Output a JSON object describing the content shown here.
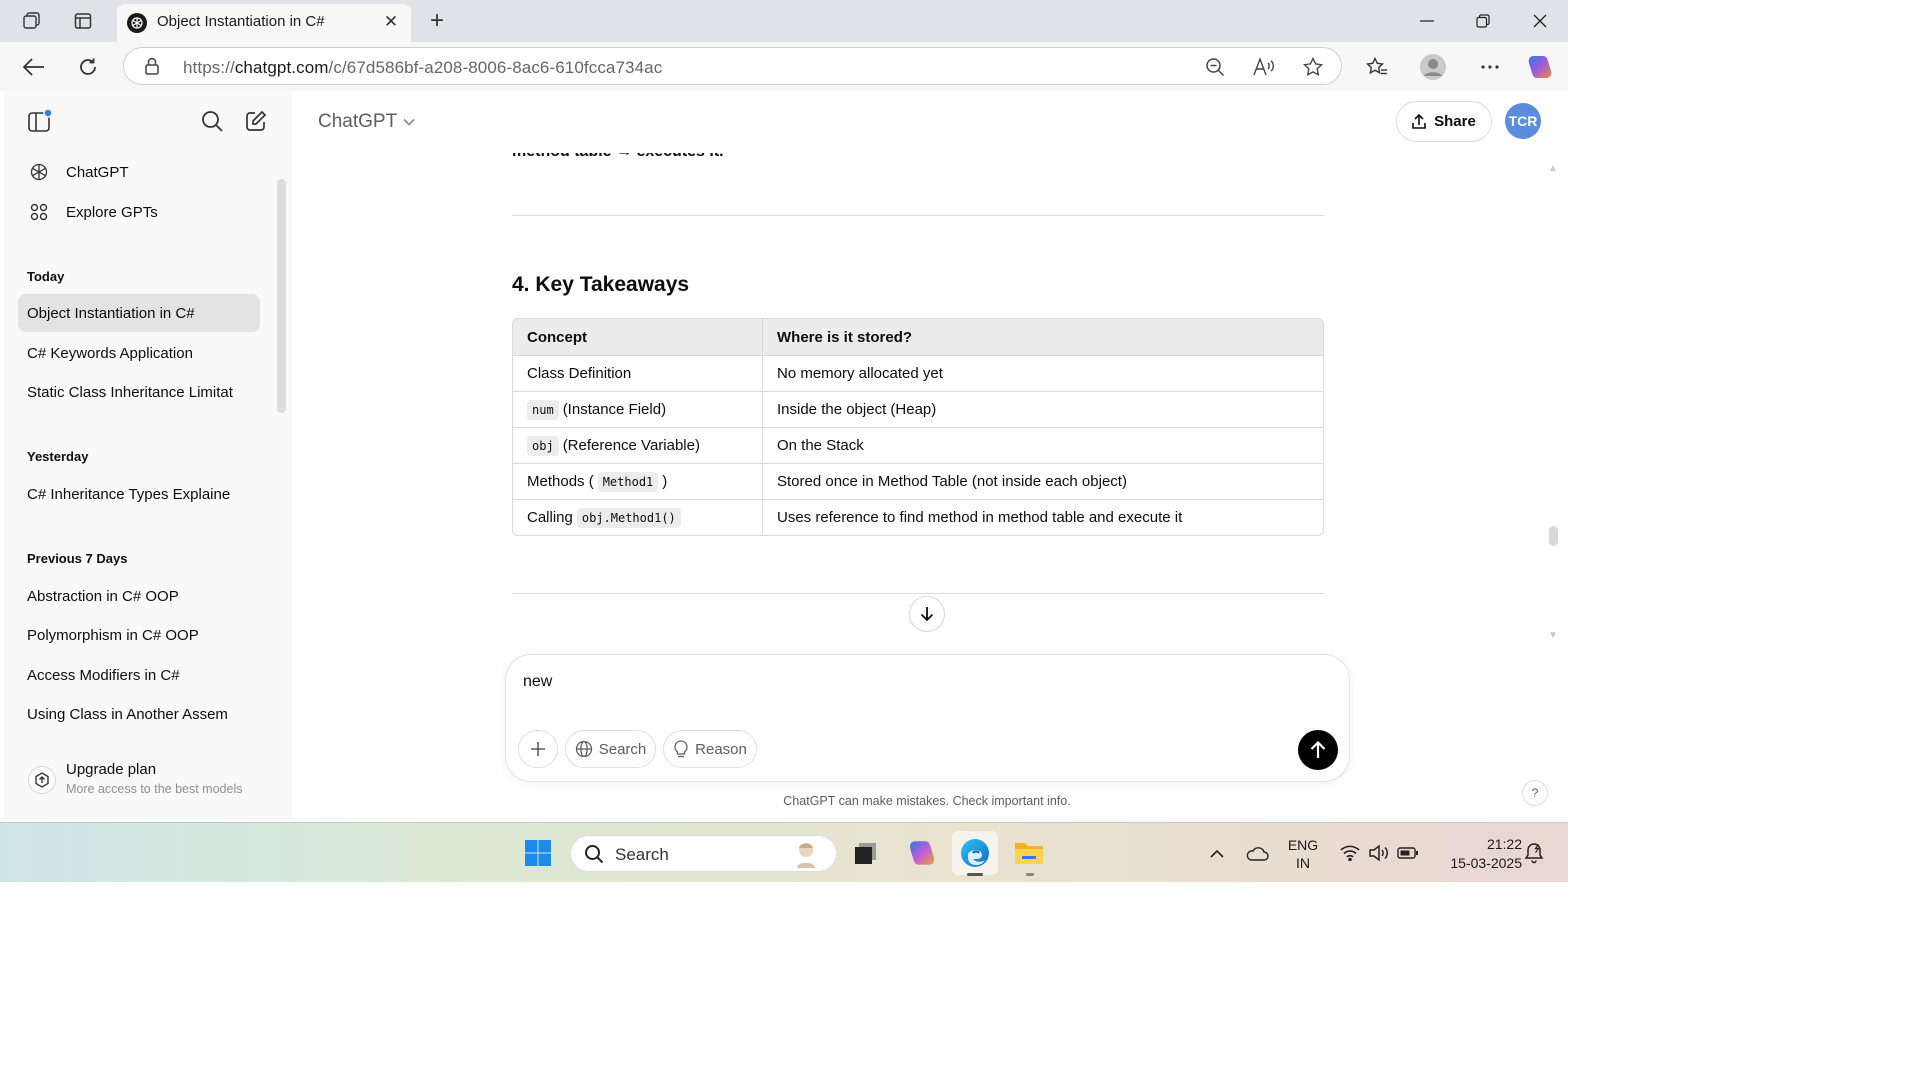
{
  "browser": {
    "tab_title": "Object Instantiation in C#",
    "url_prefix": "https://",
    "url_domain": "chatgpt.com",
    "url_path": "/c/67d586bf-a208-8006-8ac6-610fcca734ac"
  },
  "sidebar": {
    "nav": [
      {
        "label": "ChatGPT",
        "icon": "openai-logo-icon"
      },
      {
        "label": "Explore GPTs",
        "icon": "grid-icon"
      }
    ],
    "sections": [
      {
        "heading": "Today",
        "items": [
          "Object Instantiation in C#",
          "C# Keywords Application",
          "Static Class Inheritance Limitat"
        ]
      },
      {
        "heading": "Yesterday",
        "items": [
          "C# Inheritance Types Explaine"
        ]
      },
      {
        "heading": "Previous 7 Days",
        "items": [
          "Abstraction in C# OOP",
          "Polymorphism in C# OOP",
          "Access Modifiers in C#",
          "Using Class in Another Assem"
        ]
      }
    ],
    "upgrade": {
      "title": "Upgrade plan",
      "subtitle": "More access to the best models"
    }
  },
  "header": {
    "model": "ChatGPT",
    "share_label": "Share",
    "avatar_initials": "TCR"
  },
  "content": {
    "cut_off_text": "method table → executes it.",
    "section_heading": "4. Key Takeaways",
    "table": {
      "headers": [
        "Concept",
        "Where is it stored?"
      ],
      "rows": [
        {
          "concept_pre": "",
          "concept_code": "",
          "concept_post": "Class Definition",
          "stored": "No memory allocated yet"
        },
        {
          "concept_pre": "",
          "concept_code": "num",
          "concept_post": "(Instance Field)",
          "stored": "Inside the object (Heap)"
        },
        {
          "concept_pre": "",
          "concept_code": "obj",
          "concept_post": "(Reference Variable)",
          "stored": "On the Stack"
        },
        {
          "concept_pre": "Methods (",
          "concept_code": "Method1",
          "concept_post": ")",
          "stored": "Stored once in Method Table (not inside each object)"
        },
        {
          "concept_pre": "Calling",
          "concept_code": "obj.Method1()",
          "concept_post": "",
          "stored": "Uses reference to find method in method table and execute it"
        }
      ]
    }
  },
  "composer": {
    "text": "new",
    "buttons": {
      "search": "Search",
      "reason": "Reason"
    }
  },
  "disclaimer": "ChatGPT can make mistakes. Check important info.",
  "help_label": "?",
  "taskbar": {
    "search_label": "Search",
    "lang_top": "ENG",
    "lang_bottom": "IN",
    "time": "21:22",
    "date": "15-03-2025"
  },
  "colors": {
    "avatar_bg": "#5b8dde",
    "send_button": "#000000",
    "active_item_bg": "#e3e3e3"
  }
}
